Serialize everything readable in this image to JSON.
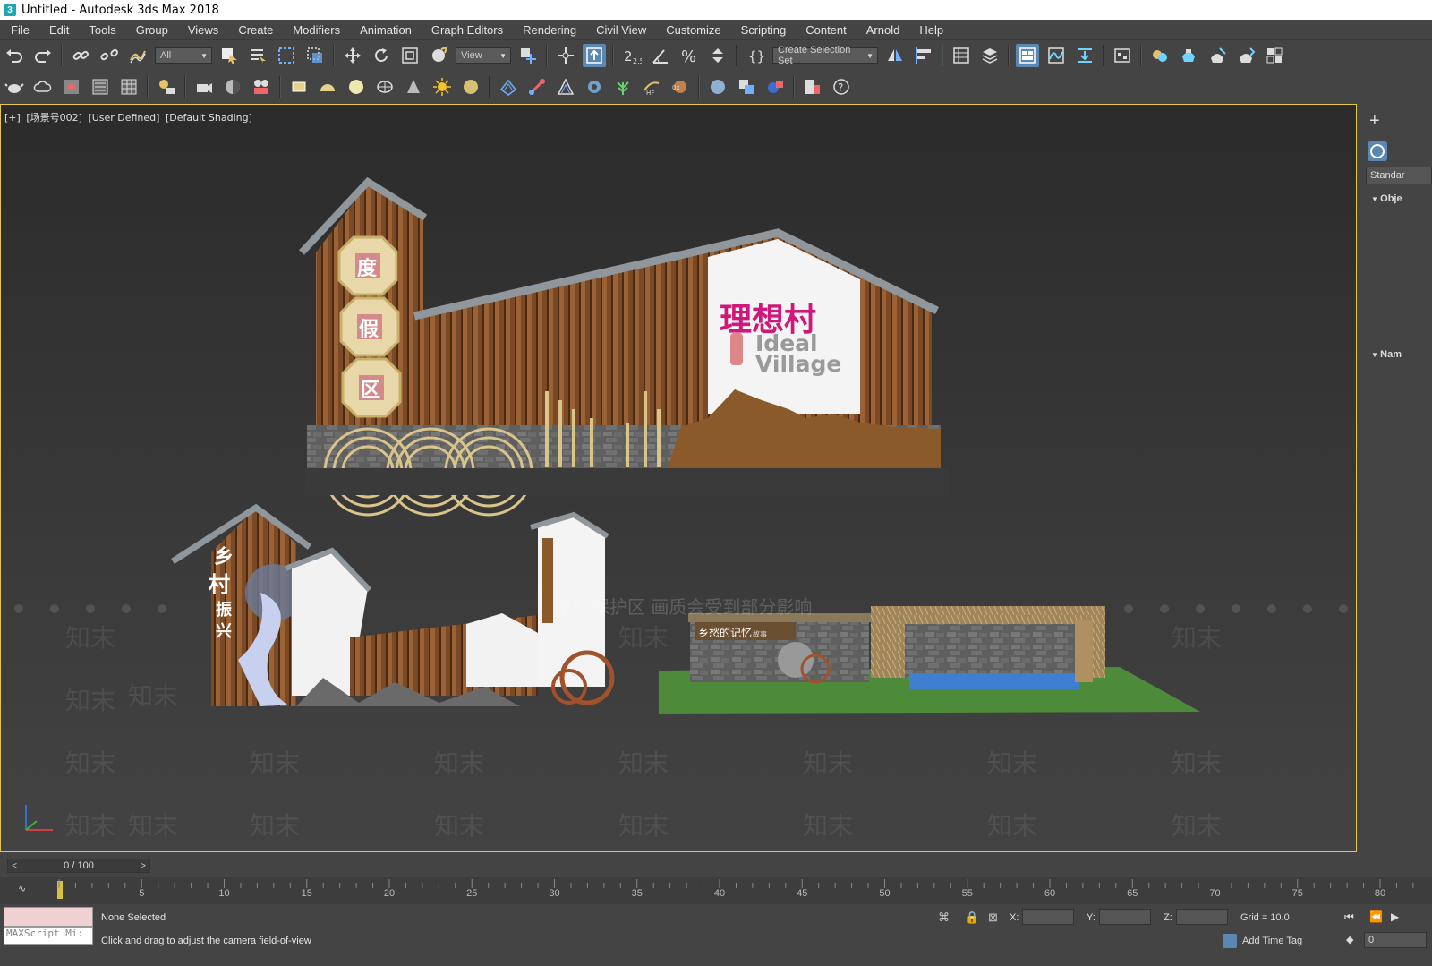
{
  "window": {
    "title": "Untitled - Autodesk 3ds Max 2018",
    "app_icon": "3"
  },
  "menu": [
    "File",
    "Edit",
    "Tools",
    "Group",
    "Views",
    "Create",
    "Modifiers",
    "Animation",
    "Graph Editors",
    "Rendering",
    "Civil View",
    "Customize",
    "Scripting",
    "Content",
    "Arnold",
    "Help"
  ],
  "toolbar": {
    "selection_filter": "All",
    "ref_coord": "View",
    "snap_label": "2.5",
    "named_selection": "Create Selection Set"
  },
  "viewport": {
    "label_parts": [
      "[+]",
      "[场景号002]",
      "[User Defined]",
      "[Default Shading]"
    ],
    "scene_text": {
      "signs_vertical": [
        "度",
        "假",
        "区"
      ],
      "main_sign_cn": "理想村",
      "main_sign_en_1": "Ideal",
      "main_sign_en_2": "Village",
      "left_wall_cn": [
        "乡",
        "村",
        "振",
        "兴"
      ],
      "middle_panel_cn": "乡愁的记忆",
      "middle_panel_sub": "故事"
    },
    "watermark": "知末",
    "watermark_note": "水印保护区 画质会受到部分影响"
  },
  "command_panel": {
    "dropdown": "Standar",
    "rollout_1": "Obje",
    "rollout_2": "Nam"
  },
  "time_slider": {
    "frame": "0 / 100",
    "prev": "<",
    "next": ">"
  },
  "trackbar": {
    "ticks": [
      "5",
      "10",
      "15",
      "20",
      "25",
      "30",
      "35",
      "40",
      "45",
      "50",
      "55",
      "60",
      "65",
      "70",
      "75",
      "80"
    ]
  },
  "status": {
    "maxscript": "MAXScript Mi:",
    "selection": "None Selected",
    "prompt": "Click and drag to adjust the camera field-of-view",
    "x_label": "X:",
    "y_label": "Y:",
    "z_label": "Z:",
    "grid": "Grid = 10.0",
    "add_time_tag": "Add Time Tag",
    "frame_field": "0"
  }
}
